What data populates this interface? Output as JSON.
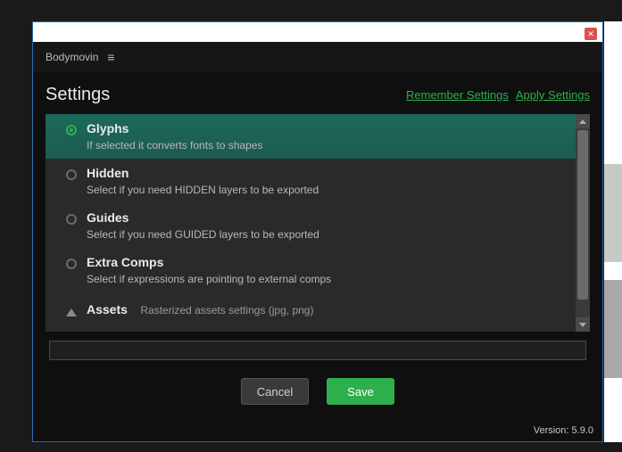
{
  "app": {
    "name": "Bodymovin"
  },
  "dialog": {
    "title": "Settings",
    "remember_link": "Remember Settings",
    "apply_link": "Apply Settings"
  },
  "options": [
    {
      "key": "glyphs",
      "title": "Glyphs",
      "desc": "If selected it converts fonts to shapes",
      "selected": true,
      "type": "radio"
    },
    {
      "key": "hidden",
      "title": "Hidden",
      "desc": "Select if you need HIDDEN layers to be exported",
      "selected": false,
      "type": "radio"
    },
    {
      "key": "guides",
      "title": "Guides",
      "desc": "Select if you need GUIDED layers to be exported",
      "selected": false,
      "type": "radio"
    },
    {
      "key": "extra-comps",
      "title": "Extra Comps",
      "desc": "Select if expressions are pointing to external comps",
      "selected": false,
      "type": "radio"
    },
    {
      "key": "assets",
      "title": "Assets",
      "inline_desc": "Rasterized assets settings (jpg, png)",
      "type": "expand"
    }
  ],
  "buttons": {
    "cancel": "Cancel",
    "save": "Save"
  },
  "footer": {
    "version_label": "Version: 5.9.0"
  },
  "colors": {
    "accent": "#2eaf4d",
    "danger": "#d9534f"
  }
}
